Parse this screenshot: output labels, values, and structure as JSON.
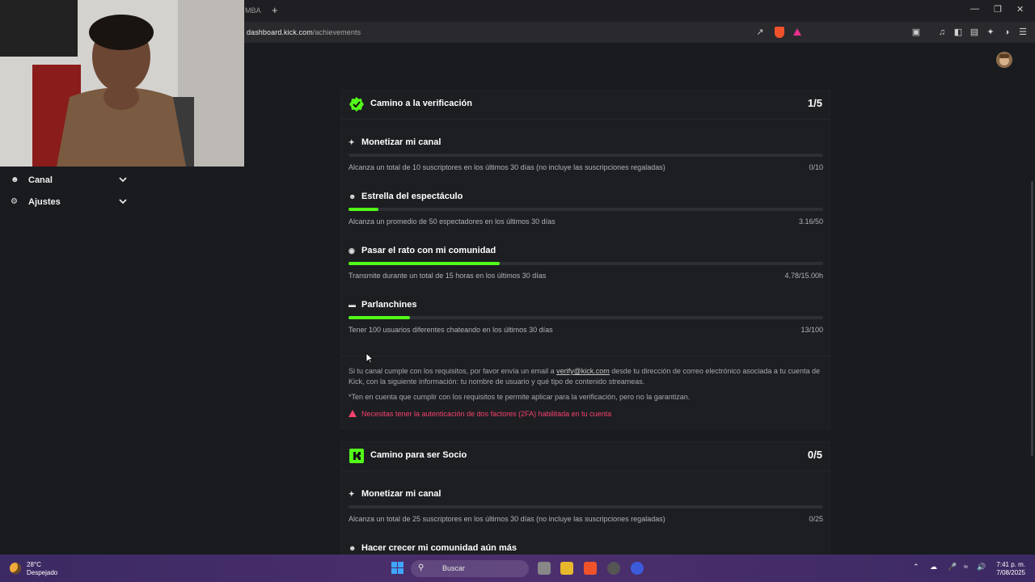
{
  "browser": {
    "tab_fragment": "MBA",
    "url_host": "dashboard.kick.com",
    "url_path": "/achievements"
  },
  "sidebar": {
    "items": [
      {
        "label": "Canal",
        "icon": "people-icon"
      },
      {
        "label": "Ajustes",
        "icon": "gear-icon"
      }
    ]
  },
  "verification": {
    "title": "Camino a la verificación",
    "count": "1/5",
    "achievements": [
      {
        "title": "Monetizar mi canal",
        "icon": "sparkle-icon",
        "desc": "Alcanza un total de 10 suscriptores en los últimos 30 días (no incluye las suscripciones regaladas)",
        "value": "0/10",
        "progress": 0.0
      },
      {
        "title": "Estrella del espectáculo",
        "icon": "people-icon",
        "desc": "Alcanza un promedio de 50 espectadores en los últimos 30 días",
        "value": "3.16/50",
        "progress": 0.063
      },
      {
        "title": "Pasar el rato con mi comunidad",
        "icon": "broadcast-icon",
        "desc": "Transmite durante un total de 15 horas en los últimos 30 días",
        "value": "4.78/15.00h",
        "progress": 0.319
      },
      {
        "title": "Parlanchines",
        "icon": "chat-icon",
        "desc": "Tener 100 usuarios diferentes chateando en los últimos 30 días",
        "value": "13/100",
        "progress": 0.13
      }
    ],
    "note_before": "Si tu canal cumple con los requisitos, por favor envía un email a ",
    "note_email": "verify@kick.com",
    "note_after": " desde tu dirección de correo electrónico asociada a tu cuenta de Kick, con la siguiente información: tu nombre de usuario y qué tipo de contenido streameas.",
    "disclaimer": "*Ten en cuenta que cumplir con los requisitos te permite aplicar para la verificación, pero no la garantizan.",
    "warning": "Necesitas tener la autenticación de dos factores (2FA) habilitada en tu cuenta"
  },
  "partner": {
    "title": "Camino para ser Socio",
    "count": "0/5",
    "achievements": [
      {
        "title": "Monetizar mi canal",
        "icon": "sparkle-icon",
        "desc": "Alcanza un total de 25 suscriptores en los últimos 30 días (no incluye las suscripciones regaladas)",
        "value": "0/25",
        "progress": 0.0
      },
      {
        "title": "Hacer crecer mi comunidad aún más",
        "icon": "people-icon",
        "desc": "",
        "value": "",
        "progress": null
      }
    ]
  },
  "taskbar": {
    "temp": "28°C",
    "weather": "Despejado",
    "search_placeholder": "Buscar",
    "time": "7:41 p. m.",
    "date": "7/08/2025"
  },
  "colors": {
    "accent": "#53fc18",
    "warning": "#f6416c",
    "background": "#191b1f"
  }
}
